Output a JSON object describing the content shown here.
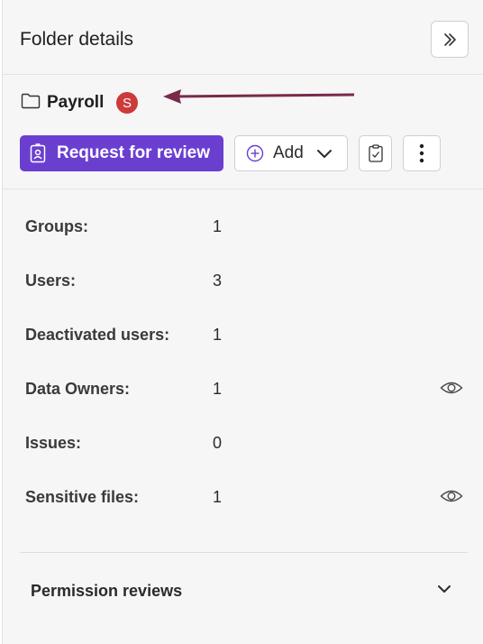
{
  "panel": {
    "title": "Folder details",
    "collapse_icon": "double-chevron-right-icon"
  },
  "folder": {
    "icon": "folder-icon",
    "name": "Payroll",
    "badge": "S",
    "badge_color": "#cc3a3a",
    "annotation_arrow_color": "#7a2a4a"
  },
  "actions": {
    "request_review_label": "Request for review",
    "request_review_icon": "badge-person-icon",
    "primary_color": "#6a3fd0",
    "add_label": "Add",
    "add_icon": "plus-circle-icon",
    "add_dropdown_icon": "chevron-down-icon",
    "clipboard_icon": "clipboard-check-icon",
    "more_icon": "more-vertical-icon"
  },
  "details": [
    {
      "label": "Groups:",
      "value": "1",
      "has_eye": false
    },
    {
      "label": "Users:",
      "value": "3",
      "has_eye": false
    },
    {
      "label": "Deactivated users:",
      "value": "1",
      "has_eye": false
    },
    {
      "label": "Data Owners:",
      "value": "1",
      "has_eye": true
    },
    {
      "label": "Issues:",
      "value": "0",
      "has_eye": false
    },
    {
      "label": "Sensitive files:",
      "value": "1",
      "has_eye": true
    }
  ],
  "accordion": {
    "label": "Permission reviews",
    "icon": "chevron-down-icon"
  }
}
